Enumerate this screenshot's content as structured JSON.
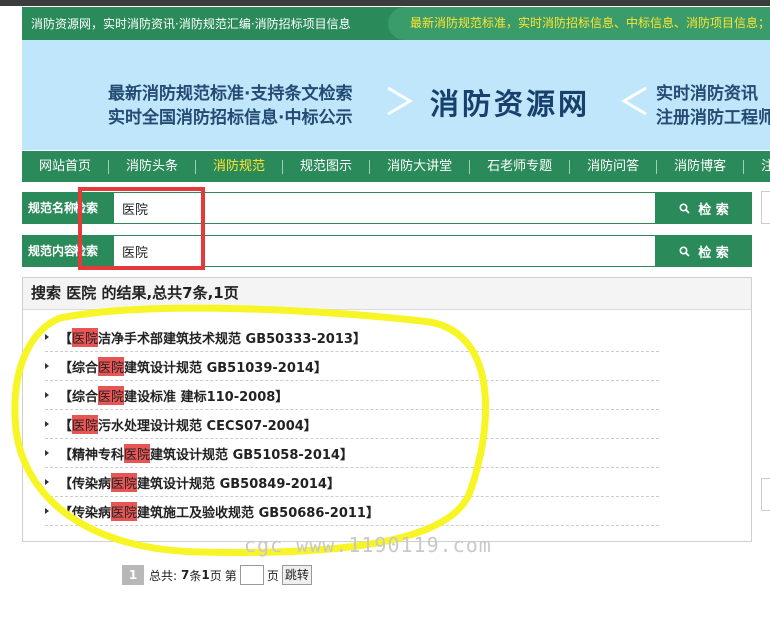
{
  "topbar": {
    "left_text": "消防资源网，实时消防资讯·消防规范汇编·消防招标项目信息",
    "right_text": "最新消防规范标准，实时消防招标信息、中标信息、消防项目信息；"
  },
  "banner": {
    "line1": "最新消防规范标准·支持条文检索",
    "line2": "实时全国消防招标信息·中标公示",
    "brand": "消防资源网",
    "right1": "实时消防资讯",
    "right2": "注册消防工程师"
  },
  "nav": {
    "items": [
      "网站首页",
      "消防头条",
      "消防规范",
      "规范图示",
      "消防大讲堂",
      "石老师专题",
      "消防问答",
      "消防博客",
      "注"
    ],
    "active_index": 2
  },
  "search": {
    "name_label_a": "规范名称",
    "name_label_b": "检索",
    "name_value": "医院",
    "content_label_a": "规范内容",
    "content_label_b": "检索",
    "content_value": "医院",
    "button_label": "检 索"
  },
  "results": {
    "heading": "搜索 医院 的结果,总共7条,1页",
    "items": [
      {
        "pre": "【",
        "a": "",
        "hl": "医院",
        "b": "洁净手术部建筑技术规范 GB50333-2013】"
      },
      {
        "pre": "【",
        "a": "综合",
        "hl": "医院",
        "b": "建筑设计规范 GB51039-2014】"
      },
      {
        "pre": "【",
        "a": "综合",
        "hl": "医院",
        "b": "建设标准 建标110-2008】"
      },
      {
        "pre": "【",
        "a": "",
        "hl": "医院",
        "b": "污水处理设计规范 CECS07-2004】"
      },
      {
        "pre": "【",
        "a": "精神专科",
        "hl": "医院",
        "b": "建筑设计规范 GB51058-2014】"
      },
      {
        "pre": "【",
        "a": "传染病",
        "hl": "医院",
        "b": "建筑设计规范 GB50849-2014】"
      },
      {
        "pre": "【",
        "a": "传染病",
        "hl": "医院",
        "b": "建筑施工及验收规范 GB50686-2011】"
      }
    ]
  },
  "watermark": "cgc www.1190119.com",
  "pager": {
    "current": "1",
    "total_label": "总共:",
    "total_count": "7",
    "unit_items": "条",
    "total_pages": "1",
    "unit_pages": "页",
    "goto_label": "第",
    "goto_suffix": "页",
    "jump_label": "跳转"
  },
  "colors": {
    "brand_green": "#2a8a5a",
    "highlight_red": "#e85555",
    "annotation_red": "#e53a3a",
    "annotation_yellow": "#f7f526",
    "nav_active": "#ffe433"
  }
}
